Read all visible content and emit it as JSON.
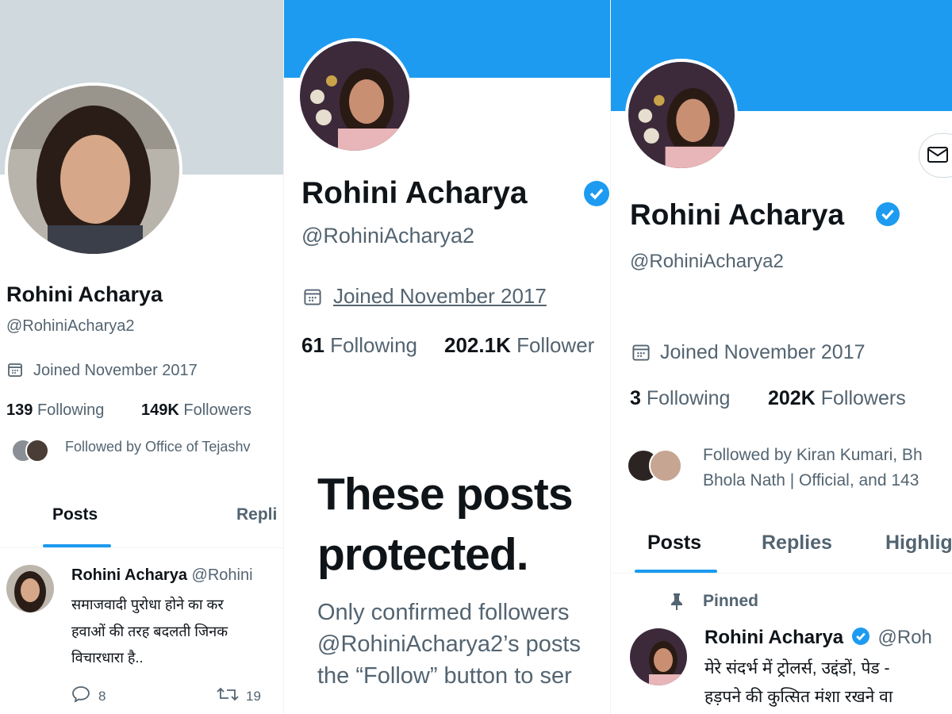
{
  "panel1": {
    "name": "Rohini Acharya",
    "handle": "@RohiniAcharya2",
    "joined": "Joined November 2017",
    "following_count": "139",
    "following_label": "Following",
    "followers_count": "149K",
    "followers_label": "Followers",
    "followed_by": "Followed by Office of Tejashv",
    "tabs": [
      "Posts",
      "Repli"
    ],
    "tweet": {
      "name": "Rohini Acharya",
      "handle": "@Rohini",
      "lines": [
        "समाजवादी पुरोधा होने का कर",
        "हवाओं की तरह बदलती जिनक",
        "विचारधारा है.."
      ],
      "replies": "8",
      "retweets": "19"
    }
  },
  "panel2": {
    "name": "Rohini Acharya",
    "handle": "@RohiniAcharya2",
    "joined": "Joined November 2017",
    "following_count": "61",
    "following_label": "Following",
    "followers_count": "202.1K",
    "followers_label": "Follower",
    "protected_title_1": "These posts",
    "protected_title_2": "protected.",
    "protected_body": [
      "Only confirmed followers",
      "@RohiniAcharya2’s posts",
      "the “Follow” button to ser"
    ]
  },
  "panel3": {
    "name": "Rohini Acharya",
    "handle": "@RohiniAcharya2",
    "joined": "Joined November 2017",
    "following_count": "3",
    "following_label": "Following",
    "followers_count": "202K",
    "followers_label": "Followers",
    "followed_by_1": "Followed by Kiran Kumari, Bh",
    "followed_by_2": "Bhola Nath | Official, and 143",
    "tabs": [
      "Posts",
      "Replies",
      "Highlig"
    ],
    "pinned": "Pinned",
    "tweet": {
      "name": "Rohini Acharya",
      "handle": "@Roh",
      "lines": [
        "मेरे संदर्भ में ट्रोलर्स, उद्दंडों, पेड -",
        "हड़पने की कुत्सित मंशा रखने वा"
      ]
    }
  },
  "colors": {
    "accent": "#1d9bf0",
    "banner_grey": "#cfd9de",
    "text_primary": "#0f1419",
    "text_secondary": "#536471"
  },
  "icons": [
    "calendar-icon",
    "verified-badge-icon",
    "reply-icon",
    "retweet-icon",
    "pin-icon",
    "mail-icon"
  ]
}
